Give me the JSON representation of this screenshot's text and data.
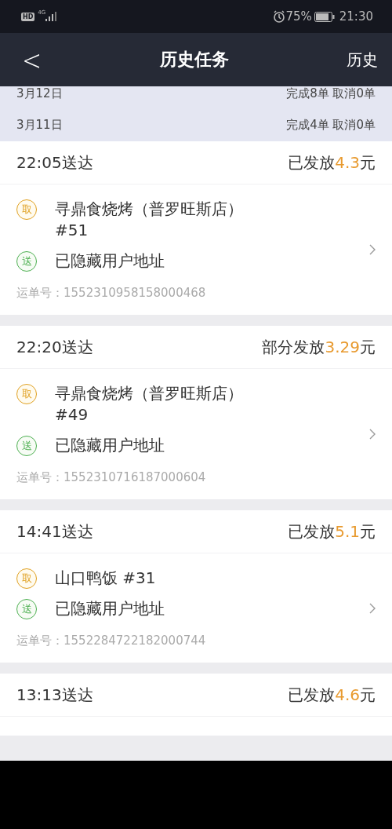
{
  "status_bar": {
    "hd": "HD",
    "network": "4G",
    "battery": "75%",
    "time": "21:30"
  },
  "nav": {
    "back": "<",
    "title": "历史任务",
    "action": "历史"
  },
  "date_rows": [
    {
      "date": "3月12日",
      "summary": "完成8单 取消0单"
    },
    {
      "date": "3月11日",
      "summary": "完成4单 取消0单"
    }
  ],
  "orders": [
    {
      "delivered": "22:05送达",
      "status": "已发放",
      "amount": "4.3",
      "unit": "元",
      "stops": [
        {
          "kind": "pickup",
          "badge": "取",
          "text": "寻鼎食烧烤（普罗旺斯店）#51"
        },
        {
          "kind": "deliver",
          "badge": "送",
          "text": "已隐藏用户地址"
        }
      ],
      "waybill": "运单号：1552310958158000468"
    },
    {
      "delivered": "22:20送达",
      "status": "部分发放",
      "amount": "3.29",
      "unit": "元",
      "stops": [
        {
          "kind": "pickup",
          "badge": "取",
          "text": "寻鼎食烧烤（普罗旺斯店）#49"
        },
        {
          "kind": "deliver",
          "badge": "送",
          "text": "已隐藏用户地址"
        }
      ],
      "waybill": "运单号：1552310716187000604"
    },
    {
      "delivered": "14:41送达",
      "status": "已发放",
      "amount": "5.1",
      "unit": "元",
      "stops": [
        {
          "kind": "pickup",
          "badge": "取",
          "text": "山口鸭饭 #31"
        },
        {
          "kind": "deliver",
          "badge": "送",
          "text": "已隐藏用户地址"
        }
      ],
      "waybill": "运单号：1552284722182000744"
    },
    {
      "delivered": "13:13送达",
      "status": "已发放",
      "amount": "4.6",
      "unit": "元"
    }
  ]
}
